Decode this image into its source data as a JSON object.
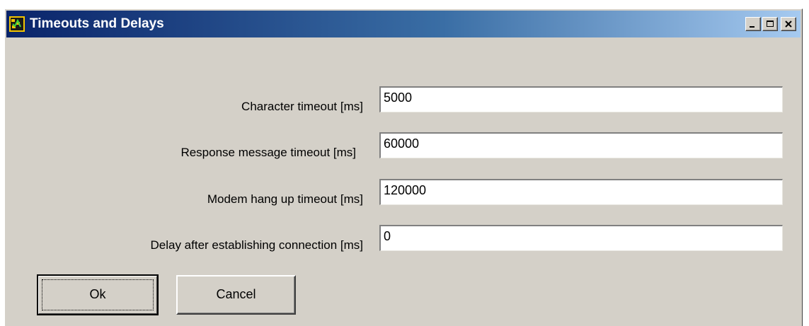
{
  "window": {
    "title": "Timeouts and Delays",
    "app_icon": "app-icon",
    "controls": {
      "minimize": "minimize-icon",
      "maximize": "maximize-icon",
      "close": "close-icon"
    }
  },
  "fields": [
    {
      "label": "Character timeout [ms]",
      "value": "5000"
    },
    {
      "label": "Response message timeout [ms]",
      "value": "60000"
    },
    {
      "label": "Modem hang up timeout [ms]",
      "value": "120000"
    },
    {
      "label": "Delay after establishing connection [ms]",
      "value": "0"
    }
  ],
  "buttons": {
    "ok_label": "Ok",
    "cancel_label": "Cancel"
  },
  "colors": {
    "face": "#d4d0c8",
    "title_start": "#0a246a",
    "title_end": "#a6caf0"
  }
}
